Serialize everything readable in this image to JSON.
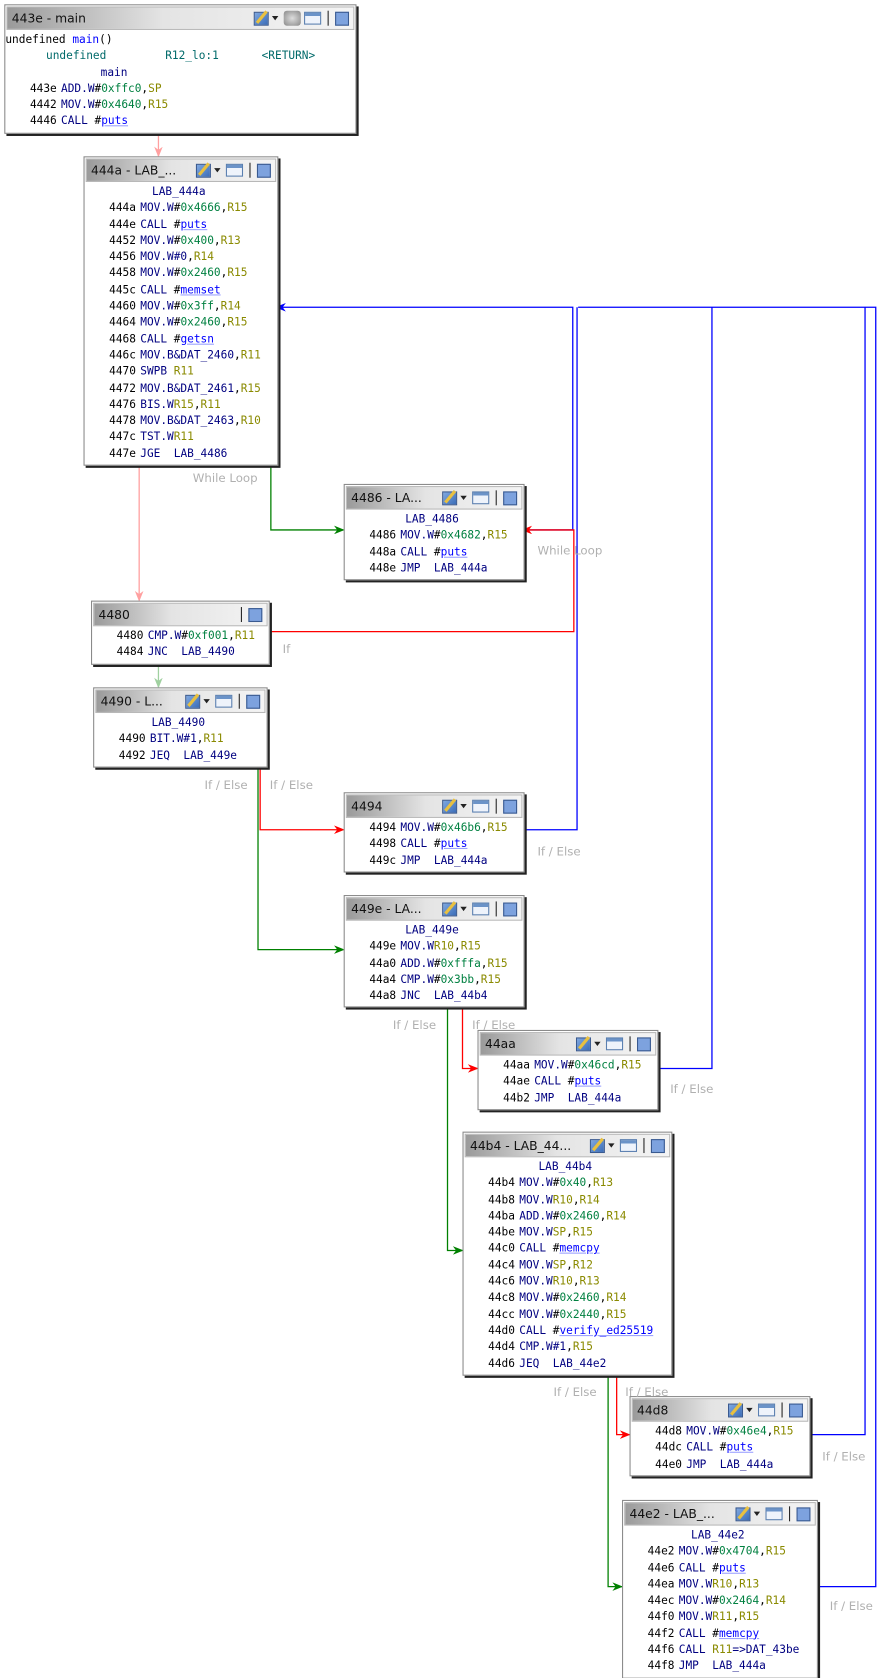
{
  "colors": {
    "true_edge": "#008000",
    "false_edge": "#ff0000",
    "back_edge": "#0000ff",
    "fallthrough": "#ffa0a0",
    "fallthrough2": "#a0d0a0"
  },
  "blocks": [
    {
      "id": "443e",
      "title": "443e - main",
      "icons": [
        "edit-icon",
        "dropdown-icon",
        "group-icon",
        "window-icon",
        "fullscreen-icon"
      ],
      "signature": {
        "ret": "undefined",
        "name": "main",
        "params": "()"
      },
      "storage": {
        "type": "undefined",
        "loc": "R12_lo:1",
        "name": "<RETURN>"
      },
      "label": "main",
      "lines": [
        {
          "a": "443e",
          "m": "ADD.W",
          "o": "#0xffc0,SP"
        },
        {
          "a": "4442",
          "m": "MOV.W",
          "o": "#0x4640,R15"
        },
        {
          "a": "4446",
          "m": "CALL",
          "o": " #puts"
        }
      ]
    },
    {
      "id": "444a",
      "title": "444a - LAB_...",
      "icons": [
        "edit-icon",
        "dropdown-icon",
        "window-icon",
        "fullscreen-icon"
      ],
      "label": "LAB_444a",
      "lines": [
        {
          "a": "444a",
          "m": "MOV.W",
          "o": "#0x4666,R15"
        },
        {
          "a": "444e",
          "m": "CALL",
          "o": " #puts"
        },
        {
          "a": "4452",
          "m": "MOV.W",
          "o": "#0x400,R13"
        },
        {
          "a": "4456",
          "m": "MOV.W",
          "o": "#0,R14"
        },
        {
          "a": "4458",
          "m": "MOV.W",
          "o": "#0x2460,R15"
        },
        {
          "a": "445c",
          "m": "CALL",
          "o": " #memset"
        },
        {
          "a": "4460",
          "m": "MOV.W",
          "o": "#0x3ff,R14"
        },
        {
          "a": "4464",
          "m": "MOV.W",
          "o": "#0x2460,R15"
        },
        {
          "a": "4468",
          "m": "CALL",
          "o": " #getsn"
        },
        {
          "a": "446c",
          "m": "MOV.B",
          "o": "&DAT_2460,R11"
        },
        {
          "a": "4470",
          "m": "SWPB",
          "o": " R11"
        },
        {
          "a": "4472",
          "m": "MOV.B",
          "o": "&DAT_2461,R15"
        },
        {
          "a": "4476",
          "m": "BIS.W",
          "o": "R15,R11"
        },
        {
          "a": "4478",
          "m": "MOV.B",
          "o": "&DAT_2463,R10"
        },
        {
          "a": "447c",
          "m": "TST.W",
          "o": "R11"
        },
        {
          "a": "447e",
          "m": "JGE",
          "o": "  LAB_4486"
        }
      ]
    },
    {
      "id": "4486",
      "title": "4486 - LA...",
      "icons": [
        "edit-icon",
        "dropdown-icon",
        "window-icon",
        "fullscreen-icon"
      ],
      "label": "LAB_4486",
      "lines": [
        {
          "a": "4486",
          "m": "MOV.W",
          "o": "#0x4682,R15"
        },
        {
          "a": "448a",
          "m": "CALL",
          "o": " #puts"
        },
        {
          "a": "448e",
          "m": "JMP",
          "o": "  LAB_444a"
        }
      ]
    },
    {
      "id": "4480",
      "title": "4480",
      "icons": [
        "fullscreen-icon"
      ],
      "lines": [
        {
          "a": "4480",
          "m": "CMP.W",
          "o": "#0xf001,R11"
        },
        {
          "a": "4484",
          "m": "JNC",
          "o": "  LAB_4490"
        }
      ]
    },
    {
      "id": "4490",
      "title": "4490 - L...",
      "icons": [
        "edit-icon",
        "dropdown-icon",
        "window-icon",
        "fullscreen-icon"
      ],
      "label": "LAB_4490",
      "lines": [
        {
          "a": "4490",
          "m": "BIT.W",
          "o": "#1,R11"
        },
        {
          "a": "4492",
          "m": "JEQ",
          "o": "  LAB_449e"
        }
      ]
    },
    {
      "id": "4494",
      "title": "4494",
      "icons": [
        "edit-icon",
        "dropdown-icon",
        "window-icon",
        "fullscreen-icon"
      ],
      "lines": [
        {
          "a": "4494",
          "m": "MOV.W",
          "o": "#0x46b6,R15"
        },
        {
          "a": "4498",
          "m": "CALL",
          "o": " #puts"
        },
        {
          "a": "449c",
          "m": "JMP",
          "o": "  LAB_444a"
        }
      ]
    },
    {
      "id": "449e",
      "title": "449e - LA...",
      "icons": [
        "edit-icon",
        "dropdown-icon",
        "window-icon",
        "fullscreen-icon"
      ],
      "label": "LAB_449e",
      "lines": [
        {
          "a": "449e",
          "m": "MOV.W",
          "o": "R10,R15"
        },
        {
          "a": "44a0",
          "m": "ADD.W",
          "o": "#0xfffa,R15"
        },
        {
          "a": "44a4",
          "m": "CMP.W",
          "o": "#0x3bb,R15"
        },
        {
          "a": "44a8",
          "m": "JNC",
          "o": "  LAB_44b4"
        }
      ]
    },
    {
      "id": "44aa",
      "title": "44aa",
      "icons": [
        "edit-icon",
        "dropdown-icon",
        "window-icon",
        "fullscreen-icon"
      ],
      "lines": [
        {
          "a": "44aa",
          "m": "MOV.W",
          "o": "#0x46cd,R15"
        },
        {
          "a": "44ae",
          "m": "CALL",
          "o": " #puts"
        },
        {
          "a": "44b2",
          "m": "JMP",
          "o": "  LAB_444a"
        }
      ]
    },
    {
      "id": "44b4",
      "title": "44b4 - LAB_44...",
      "icons": [
        "edit-icon",
        "dropdown-icon",
        "window-icon",
        "fullscreen-icon"
      ],
      "label": "LAB_44b4",
      "lines": [
        {
          "a": "44b4",
          "m": "MOV.W",
          "o": "#0x40,R13"
        },
        {
          "a": "44b8",
          "m": "MOV.W",
          "o": "R10,R14"
        },
        {
          "a": "44ba",
          "m": "ADD.W",
          "o": "#0x2460,R14"
        },
        {
          "a": "44be",
          "m": "MOV.W",
          "o": "SP,R15"
        },
        {
          "a": "44c0",
          "m": "CALL",
          "o": " #memcpy"
        },
        {
          "a": "44c4",
          "m": "MOV.W",
          "o": "SP,R12"
        },
        {
          "a": "44c6",
          "m": "MOV.W",
          "o": "R10,R13"
        },
        {
          "a": "44c8",
          "m": "MOV.W",
          "o": "#0x2460,R14"
        },
        {
          "a": "44cc",
          "m": "MOV.W",
          "o": "#0x2440,R15"
        },
        {
          "a": "44d0",
          "m": "CALL",
          "o": " #verify_ed25519"
        },
        {
          "a": "44d4",
          "m": "CMP.W",
          "o": "#1,R15"
        },
        {
          "a": "44d6",
          "m": "JEQ",
          "o": "  LAB_44e2"
        }
      ]
    },
    {
      "id": "44d8",
      "title": "44d8",
      "icons": [
        "edit-icon",
        "dropdown-icon",
        "window-icon",
        "fullscreen-icon"
      ],
      "lines": [
        {
          "a": "44d8",
          "m": "MOV.W",
          "o": "#0x46e4,R15"
        },
        {
          "a": "44dc",
          "m": "CALL",
          "o": " #puts"
        },
        {
          "a": "44e0",
          "m": "JMP",
          "o": "  LAB_444a"
        }
      ]
    },
    {
      "id": "44e2",
      "title": "44e2 - LAB_...",
      "icons": [
        "edit-icon",
        "dropdown-icon",
        "window-icon",
        "fullscreen-icon"
      ],
      "label": "LAB_44e2",
      "lines": [
        {
          "a": "44e2",
          "m": "MOV.W",
          "o": "#0x4704,R15"
        },
        {
          "a": "44e6",
          "m": "CALL",
          "o": " #puts"
        },
        {
          "a": "44ea",
          "m": "MOV.W",
          "o": "R10,R13"
        },
        {
          "a": "44ec",
          "m": "MOV.W",
          "o": "#0x2464,R14"
        },
        {
          "a": "44f0",
          "m": "MOV.W",
          "o": "R11,R15"
        },
        {
          "a": "44f2",
          "m": "CALL",
          "o": " #memcpy"
        },
        {
          "a": "44f6",
          "m": "CALL",
          "o": " R11=>DAT_43be"
        },
        {
          "a": "44f8",
          "m": "JMP",
          "o": "  LAB_444a"
        }
      ]
    }
  ],
  "edge_labels": [
    "While Loop",
    "While Loop",
    "If",
    "If / Else",
    "If / Else",
    "If / Else",
    "If / Else",
    "If / Else",
    "If / Else",
    "If / Else",
    "If / Else",
    "If / Else",
    "If / Else"
  ]
}
